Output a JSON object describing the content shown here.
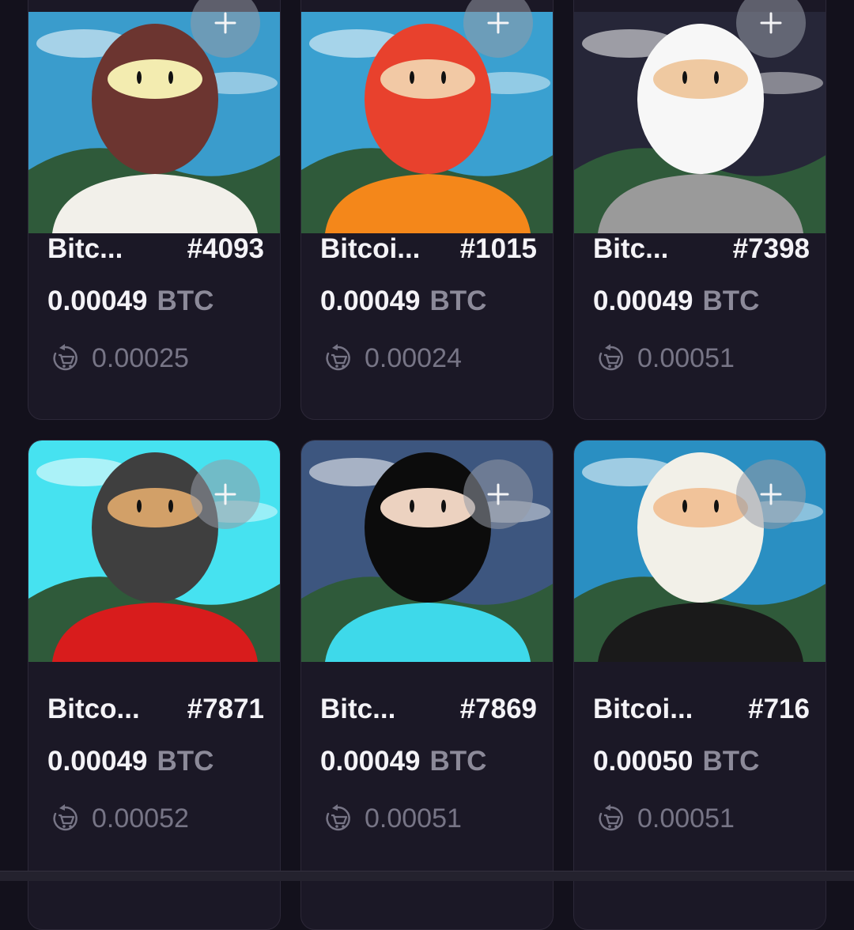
{
  "listings": [
    {
      "name": "Bitc...",
      "number": "#4093",
      "price": "0.00049",
      "currency": "BTC",
      "last_sale": "0.00025",
      "art_palette": {
        "sky": "#3a9ccc",
        "hood": "#6c3530",
        "shirt": "#f2f0ea",
        "face": "#f3ecb0"
      }
    },
    {
      "name": "Bitcoi...",
      "number": "#1015",
      "price": "0.00049",
      "currency": "BTC",
      "last_sale": "0.00024",
      "art_palette": {
        "sky": "#3aa0d0",
        "hood": "#e8412d",
        "shirt": "#f4871a",
        "face": "#f2c9a5"
      }
    },
    {
      "name": "Bitc...",
      "number": "#7398",
      "price": "0.00049",
      "currency": "BTC",
      "last_sale": "0.00051",
      "art_palette": {
        "sky": "#262638",
        "hood": "#f7f7f7",
        "shirt": "#9a9a9a",
        "face": "#efc9a1"
      }
    },
    {
      "name": "Bitco...",
      "number": "#7871",
      "price": "0.00049",
      "currency": "BTC",
      "last_sale": "0.00052",
      "art_palette": {
        "sky": "#46e2f0",
        "hood": "#3f3f3f",
        "shirt": "#d81c1c",
        "face": "#d2a068"
      }
    },
    {
      "name": "Bitc...",
      "number": "#7869",
      "price": "0.00049",
      "currency": "BTC",
      "last_sale": "0.00051",
      "art_palette": {
        "sky": "#3d567f",
        "hood": "#0c0c0c",
        "shirt": "#3ed9ea",
        "face": "#ecd2c0"
      }
    },
    {
      "name": "Bitcoi...",
      "number": "#716",
      "price": "0.00050",
      "currency": "BTC",
      "last_sale": "0.00051",
      "art_palette": {
        "sky": "#2a8fc2",
        "hood": "#f2f0e8",
        "shirt": "#1a1a1a",
        "face": "#f1c39a"
      }
    }
  ],
  "icons": {
    "add": "plus-icon",
    "last_sale": "cart-refresh-icon"
  },
  "colors": {
    "background": "#13111c",
    "card": "#1b1826",
    "text": "#f4f3f7",
    "muted": "#8c8a99"
  }
}
